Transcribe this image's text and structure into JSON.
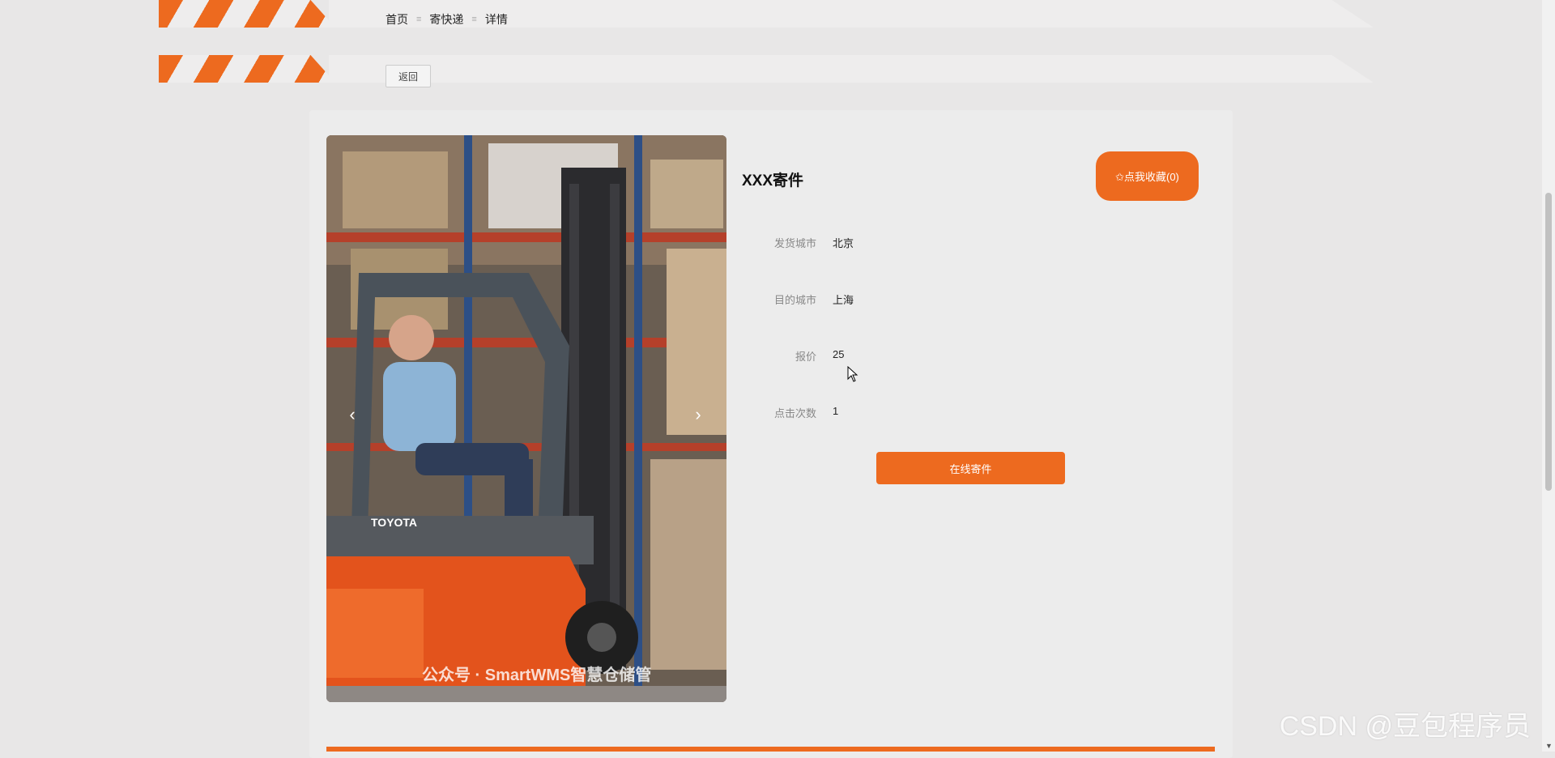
{
  "breadcrumb": {
    "home": "首页",
    "section": "寄快递",
    "current": "详情",
    "separator": "≡"
  },
  "back_button": "返回",
  "product": {
    "title": "XXX寄件",
    "favorite_button": "✩点我收藏(0)",
    "fields": [
      {
        "label": "发货城市",
        "value": "北京"
      },
      {
        "label": "目的城市",
        "value": "上海"
      },
      {
        "label": "报价",
        "value": "25"
      },
      {
        "label": "点击次数",
        "value": "1"
      }
    ],
    "send_button": "在线寄件"
  },
  "carousel": {
    "prev": "‹",
    "next": "›",
    "image_caption": "公众号 · SmartWMS智慧仓储管",
    "brand_text": "TOYOTA"
  },
  "watermark": "CSDN @豆包程序员",
  "colors": {
    "accent": "#ed6a1f",
    "background": "#e8e7e7"
  }
}
